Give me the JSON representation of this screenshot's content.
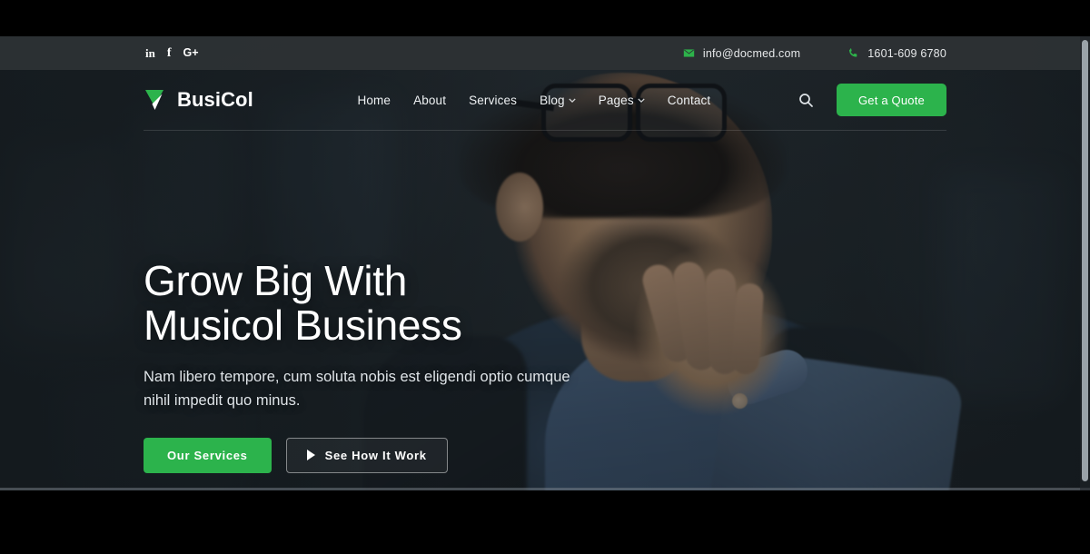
{
  "topbar": {
    "social": [
      {
        "name": "linkedin",
        "glyph": "in"
      },
      {
        "name": "facebook",
        "glyph": "f"
      },
      {
        "name": "google-plus",
        "glyph": "G+"
      }
    ],
    "email": {
      "icon": "envelope-icon",
      "text": "info@docmed.com"
    },
    "phone": {
      "icon": "phone-icon",
      "text": "1601-609 6780"
    }
  },
  "header": {
    "brand": {
      "text": "BusiCol",
      "icon": "triangle-check-logo-icon"
    },
    "nav": [
      {
        "label": "Home",
        "has_dropdown": false
      },
      {
        "label": "About",
        "has_dropdown": false
      },
      {
        "label": "Services",
        "has_dropdown": false
      },
      {
        "label": "Blog",
        "has_dropdown": true
      },
      {
        "label": "Pages",
        "has_dropdown": true
      },
      {
        "label": "Contact",
        "has_dropdown": false
      }
    ],
    "search_icon": "search-icon",
    "quote_button": "Get a Quote"
  },
  "hero": {
    "title_line1": "Grow Big With",
    "title_line2": "Musicol Business",
    "subtitle": "Nam libero tempore, cum soluta nobis est eligendi optio cumque nihil impedit quo minus.",
    "primary_button": "Our Services",
    "secondary_button": "See How It Work",
    "secondary_button_icon": "play-icon"
  },
  "colors": {
    "accent_green": "#2cb34c",
    "topbar_bg": "#2d3134",
    "text_light": "#ffffff",
    "body_black": "#000000"
  }
}
